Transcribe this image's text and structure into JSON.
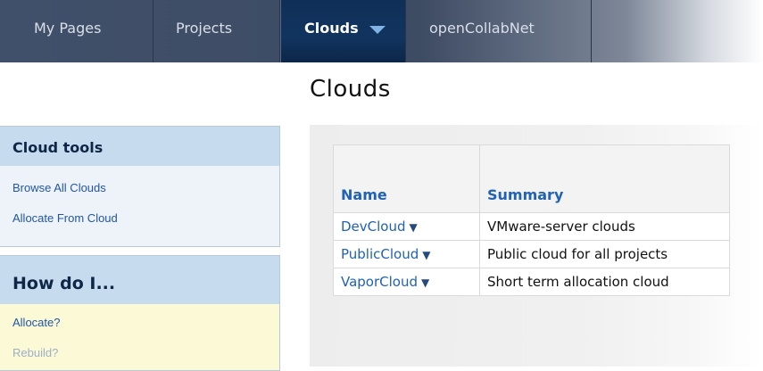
{
  "nav": {
    "tabs": [
      {
        "label": "My Pages"
      },
      {
        "label": "Projects"
      },
      {
        "label": "Clouds"
      },
      {
        "label": "openCollabNet"
      }
    ]
  },
  "sidebar": {
    "cloud_tools": {
      "title": "Cloud tools",
      "links": [
        "Browse All Clouds",
        "Allocate From Cloud"
      ]
    },
    "how_do_i": {
      "title": "How do I...",
      "links": [
        "Allocate?",
        "Rebuild?"
      ]
    }
  },
  "main": {
    "title": "Clouds",
    "table": {
      "headers": [
        "Name",
        "Summary"
      ],
      "rows": [
        {
          "name": "DevCloud",
          "summary": "VMware-server clouds"
        },
        {
          "name": "PublicCloud",
          "summary": "Public cloud for all projects"
        },
        {
          "name": "VaporCloud",
          "summary": "Short term allocation cloud"
        }
      ]
    }
  },
  "colors": {
    "nav_bg": "#3d4b63",
    "active_tab": "#11345f",
    "link": "#2062b5",
    "sidebar_head": "#c7dbee",
    "howdo_bg": "#fbf9d6"
  }
}
